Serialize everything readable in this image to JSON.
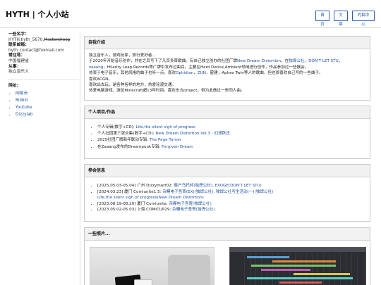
{
  "header": {
    "site_title": "HYTH | 个人小站",
    "nav": [
      "首页",
      "文章",
      "约稿中心"
    ]
  },
  "sidebar": {
    "name_label": "一些名字：",
    "name_value_plain": "HYTH,hyth_5670,",
    "name_value_struck": "Mastershoop",
    "email_label": "联系邮箱：",
    "email_value": "hyth_contact@foxmail.com",
    "location_label": "常住地：",
    "location_value": "中国福建省",
    "job_label": "从事：",
    "job_value": "独立音乐人",
    "links_label": "网址:",
    "links": [
      "网易云",
      "Bilibili",
      "Youtube",
      "Dizzylab"
    ]
  },
  "intro": {
    "title": "自我介绍",
    "l1": "独立音乐人，游戏玩家，旅行爱好者...",
    "l2a": "于2020年开始音乐创作，并在之后写下了几百多首歌曲。有自己独立创办的社团厂牌",
    "l2_link1": "New Dream Distortion",
    "l2b": "，在",
    "l2_link2": "独焊公社",
    "l2c": "，",
    "l2_link3": "DON'T LET STU",
    "l2d": "，",
    "l3_link": "zaaang",
    "l3": "，Hilarity Leap Records等厂牌中发布过曲目。主要在Hard Dance,Ambient领域进行创作，作品参加过一些展会。",
    "l4a": "热衷于电子音乐，其他风格的曲子也听一点。喜欢",
    "l4_link1": "Ophidian",
    "l4b": "，",
    "l4_link2": "ZUN",
    "l4c": "，霍建，Aphex Twin等人的歌曲，但也很喜欢自己写的一些曲子。",
    "l5": "喜欢ACGN。",
    "l6": "喜欢出去玩，是各种各样的地方，热爱轮渡交通。",
    "l7": "热爱电脑游戏，游玩Minecraft超13年时间。喜欢东方project，但为此做过一些同人曲。"
  },
  "projects": {
    "title": "个人项目/作品",
    "items": [
      {
        "text": "个人专辑(数字+CD): ",
        "link": "Life,the silent sigh of progress"
      },
      {
        "text": "个人社团第三张合集(数字+CD): ",
        "link": "New Dream Distortion Vol.3 - 幻想跃迁"
      },
      {
        "text": "2025社团厂牌新年联动专辑: ",
        "link": "The Page Turner"
      },
      {
        "text": "在Zaaang发布的Dreampunk专辑: ",
        "link": "Forgiven Dream"
      }
    ]
  },
  "events": {
    "title": "参会信息",
    "e1_text": "[2025.05.03-05.04] 广州 Dizzymart02: ",
    "e1_link": "摄户乌托邦(独焊公社), EXOGE(DON'T LET STU)",
    "e2_text": "[2024.03.23] 厦门 Comiunite1.5: ",
    "e2_link": "杂糧电子吾寄(EX)(独焊公社), 独焊公社写生活动(一)(独焊公社)",
    "e2_line2": "Life,the silent sigh of progress(New Dream Distortion)",
    "e3_text": "[2023.08.19-08.20] 厦门 Comiunite: ",
    "e3_link": "杂糧电子吾寄(独焊公社)",
    "e4_text": "[2023.05.02-05.03] 上海 COMICUP29: ",
    "e4_link": "杂糧电子吾寄(独焊公社)"
  },
  "photos": {
    "title": "一些照片..."
  }
}
